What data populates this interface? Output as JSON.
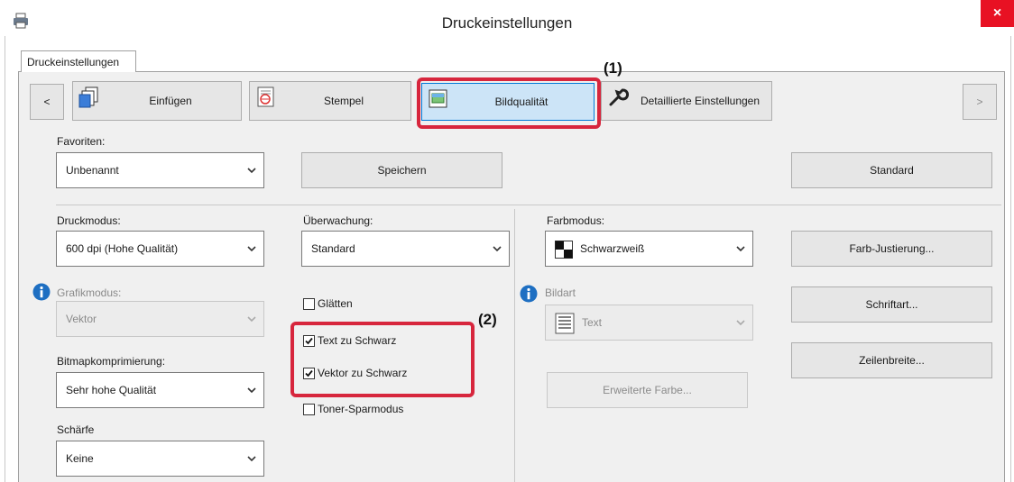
{
  "window": {
    "title": "Druckeinstellungen",
    "close_label": "×"
  },
  "outer_tab": {
    "label": "Druckeinstellungen"
  },
  "nav": {
    "prev_label": "<",
    "next_label": ">",
    "tabs": [
      {
        "label": "Einfügen",
        "icon": "pages-icon"
      },
      {
        "label": "Stempel",
        "icon": "stamp-icon"
      },
      {
        "label": "Bildqualität",
        "icon": "image-quality-icon",
        "selected": true
      },
      {
        "label": "Detaillierte Einstellungen",
        "icon": "wrench-icon"
      }
    ]
  },
  "favorites": {
    "label": "Favoriten:",
    "value": "Unbenannt",
    "save_label": "Speichern",
    "default_label": "Standard"
  },
  "druckmodus": {
    "label": "Druckmodus:",
    "value": "600 dpi (Hohe Qualität)"
  },
  "ueberwachung": {
    "label": "Überwachung:",
    "value": "Standard"
  },
  "farbmodus": {
    "label": "Farbmodus:",
    "value": "Schwarzweiß"
  },
  "grafikmodus": {
    "label": "Grafikmodus:",
    "value": "Vektor"
  },
  "bildart": {
    "label": "Bildart",
    "value": "Text"
  },
  "bitmap": {
    "label": "Bitmapkomprimierung:",
    "value": "Sehr hohe Qualität"
  },
  "schaerfe": {
    "label": "Schärfe",
    "value": "Keine"
  },
  "checkboxes": {
    "glaetten": {
      "label": "Glätten",
      "checked": false
    },
    "text_schwarz": {
      "label": "Text zu Schwarz",
      "checked": true
    },
    "vektor_schwarz": {
      "label": "Vektor zu Schwarz",
      "checked": true
    },
    "toner": {
      "label": "Toner-Sparmodus",
      "checked": false
    }
  },
  "buttons": {
    "farb_justierung": "Farb-Justierung...",
    "schriftart": "Schriftart...",
    "zeilenbreite": "Zeilenbreite...",
    "erweiterte_farbe": "Erweiterte Farbe..."
  },
  "callouts": {
    "one": "(1)",
    "two": "(2)"
  },
  "colors": {
    "accent": "#0078d7",
    "close": "#e81123",
    "callout": "#d7263d",
    "selected_bg": "#cce4f7"
  }
}
